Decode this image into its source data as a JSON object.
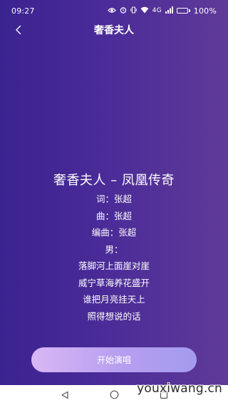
{
  "status_bar": {
    "time": "09:27",
    "signal_text": "4G",
    "battery_text": "100%",
    "battery_level": 1.0
  },
  "header": {
    "title": "奢香夫人",
    "back_icon": "chevron-left-icon"
  },
  "lyrics": {
    "song_title": "奢香夫人 – 凤凰传奇",
    "lines": [
      "词：张超",
      "曲：张超",
      "编曲：张超",
      "男：",
      "落脚河上面崖对崖",
      "威宁草海养花盛开",
      "谁把月亮挂天上",
      "照得想说的话"
    ]
  },
  "actions": {
    "start_singing_label": "开始演唱"
  },
  "nav_bar": {
    "back_icon": "triangle-back-icon",
    "home_icon": "circle-home-icon",
    "recent_icon": "square-recent-icon"
  },
  "watermark": {
    "text": "youxiwang.cn"
  },
  "colors": {
    "background_left": "#3a2390",
    "background_right": "#5f3a98",
    "button_gradient_start": "#d9b7f4",
    "button_gradient_end": "#a49bee"
  }
}
